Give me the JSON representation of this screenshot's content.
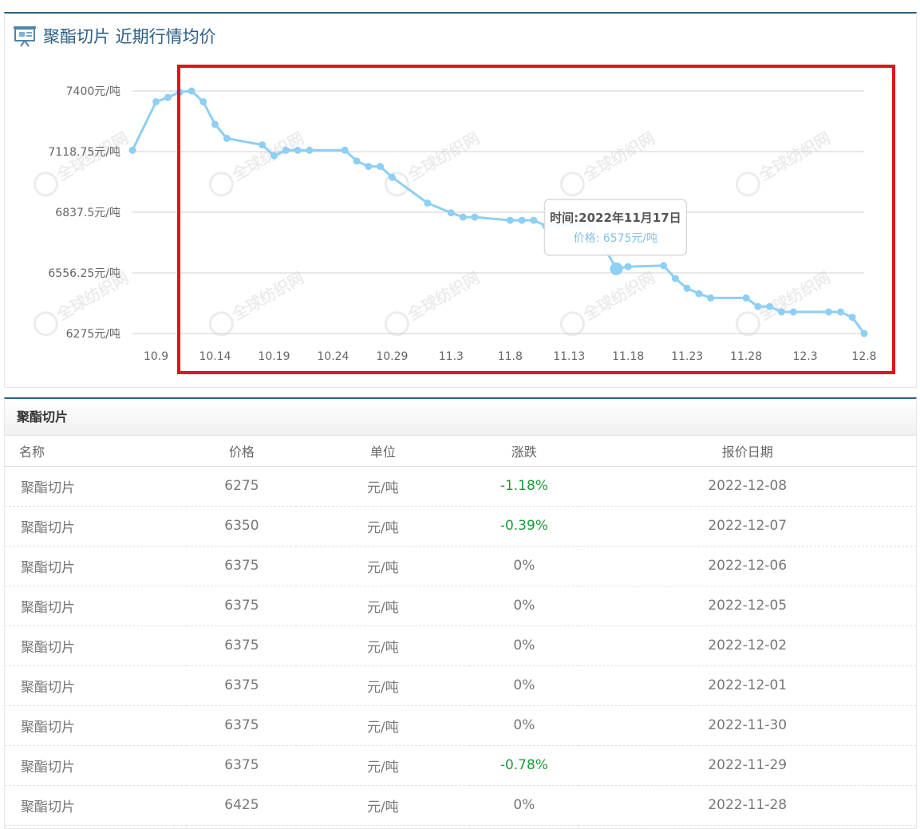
{
  "chart_panel": {
    "title": "聚酯切片 近期行情均价",
    "watermark": "全球纺织网"
  },
  "chart_data": {
    "type": "line",
    "unit": "元/吨",
    "ylim": [
      6275,
      7400
    ],
    "y_ticks": [
      "6275元/吨",
      "6556.25元/吨",
      "6837.5元/吨",
      "7118.75元/吨",
      "7400元/吨"
    ],
    "x_ticks": [
      "10.9",
      "10.14",
      "10.19",
      "10.24",
      "10.29",
      "11.3",
      "11.8",
      "11.13",
      "11.18",
      "11.23",
      "11.28",
      "12.3",
      "12.8"
    ],
    "grid": true,
    "legend": "none",
    "line_color": "#8ecff4",
    "x": [
      "2022-10-07",
      "2022-10-09",
      "2022-10-10",
      "2022-10-11",
      "2022-10-12",
      "2022-10-13",
      "2022-10-14",
      "2022-10-15",
      "2022-10-18",
      "2022-10-19",
      "2022-10-20",
      "2022-10-21",
      "2022-10-22",
      "2022-10-25",
      "2022-10-26",
      "2022-10-27",
      "2022-10-28",
      "2022-10-29",
      "2022-11-01",
      "2022-11-03",
      "2022-11-04",
      "2022-11-05",
      "2022-11-08",
      "2022-11-09",
      "2022-11-10",
      "2022-11-11",
      "2022-11-12",
      "2022-11-14",
      "2022-11-15",
      "2022-11-17",
      "2022-11-18",
      "2022-11-21",
      "2022-11-22",
      "2022-11-23",
      "2022-11-24",
      "2022-11-25",
      "2022-11-28",
      "2022-11-29",
      "2022-11-30",
      "2022-12-01",
      "2022-12-02",
      "2022-12-05",
      "2022-12-06",
      "2022-12-07",
      "2022-12-08"
    ],
    "values": [
      7125,
      7350,
      7370,
      7395,
      7400,
      7350,
      7245,
      7180,
      7150,
      7100,
      7125,
      7125,
      7125,
      7125,
      7075,
      7050,
      7050,
      7000,
      6880,
      6835,
      6815,
      6815,
      6800,
      6800,
      6800,
      6775,
      6775,
      6780,
      6770,
      6575,
      6585,
      6590,
      6530,
      6485,
      6460,
      6440,
      6440,
      6400,
      6400,
      6375,
      6375,
      6375,
      6375,
      6350,
      6275
    ],
    "tooltip": {
      "time_label": "时间:",
      "time_value": "2022年11月17日",
      "price_label": "价格: ",
      "price_value": "6575元/吨"
    }
  },
  "table_panel": {
    "title": "聚酯切片",
    "columns": [
      "名称",
      "价格",
      "单位",
      "涨跌",
      "报价日期"
    ],
    "rows": [
      {
        "name": "聚酯切片",
        "price": "6275",
        "unit": "元/吨",
        "change": "-1.18%",
        "date": "2022-12-08"
      },
      {
        "name": "聚酯切片",
        "price": "6350",
        "unit": "元/吨",
        "change": "-0.39%",
        "date": "2022-12-07"
      },
      {
        "name": "聚酯切片",
        "price": "6375",
        "unit": "元/吨",
        "change": "0%",
        "date": "2022-12-06"
      },
      {
        "name": "聚酯切片",
        "price": "6375",
        "unit": "元/吨",
        "change": "0%",
        "date": "2022-12-05"
      },
      {
        "name": "聚酯切片",
        "price": "6375",
        "unit": "元/吨",
        "change": "0%",
        "date": "2022-12-02"
      },
      {
        "name": "聚酯切片",
        "price": "6375",
        "unit": "元/吨",
        "change": "0%",
        "date": "2022-12-01"
      },
      {
        "name": "聚酯切片",
        "price": "6375",
        "unit": "元/吨",
        "change": "0%",
        "date": "2022-11-30"
      },
      {
        "name": "聚酯切片",
        "price": "6375",
        "unit": "元/吨",
        "change": "-0.78%",
        "date": "2022-11-29"
      },
      {
        "name": "聚酯切片",
        "price": "6425",
        "unit": "元/吨",
        "change": "0%",
        "date": "2022-11-28"
      }
    ]
  }
}
